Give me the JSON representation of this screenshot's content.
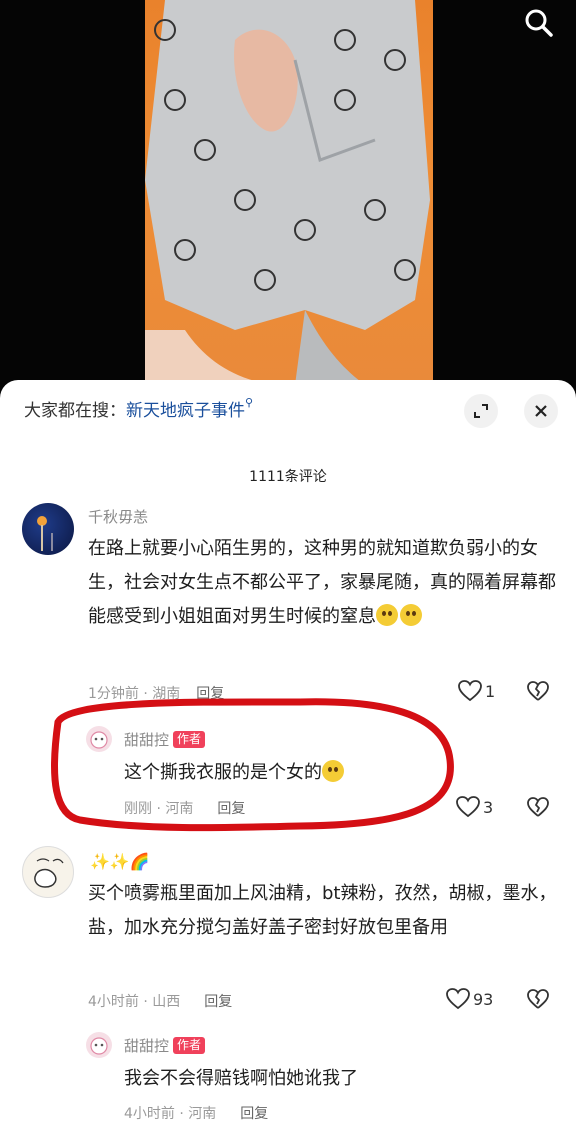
{
  "search_hint": {
    "prefix": "大家都在搜：",
    "term": "新天地疯子事件"
  },
  "comment_count": "1111条评论",
  "comments": [
    {
      "user": "千秋毋恙",
      "text": "在路上就要小心陌生男的，这种男的就知道欺负弱小的女生，社会对女生点不都公平了，家暴尾随，真的隔着屏幕都能感受到小姐姐面对男生时候的窒息",
      "meta": "1分钟前 · 湖南",
      "reply": "回复",
      "likes": "1"
    },
    {
      "user": "甜甜控",
      "tag": "作者",
      "text": "这个撕我衣服的是个女的",
      "meta": "刚刚 · 河南",
      "reply": "回复",
      "likes": "3"
    },
    {
      "user": "",
      "text": "买个喷雾瓶里面加上风油精，bt辣粉，孜然，胡椒，墨水，盐，加水充分搅匀盖好盖子密封好放包里备用",
      "meta": "4小时前 · 山西",
      "reply": "回复",
      "likes": "93"
    },
    {
      "user": "甜甜控",
      "tag": "作者",
      "text": "我会不会得赔钱啊怕她讹我了",
      "meta": "4小时前 · 河南",
      "reply": "回复"
    }
  ],
  "colors": {
    "link": "#1a4f9c",
    "author_tag": "#f0415b",
    "annotation": "#d40f14"
  }
}
